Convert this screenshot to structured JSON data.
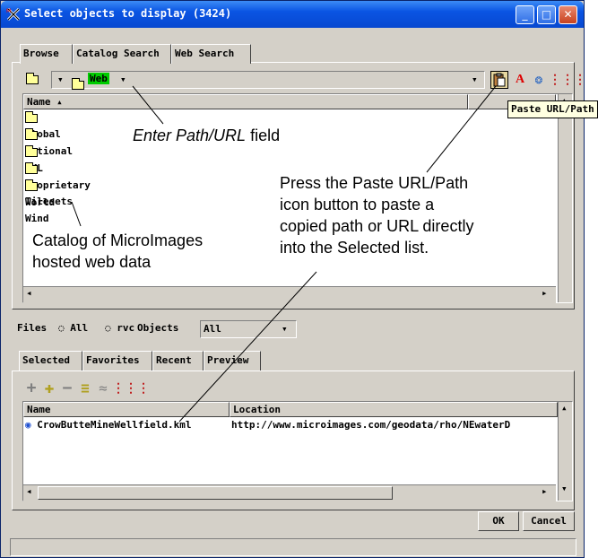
{
  "window": {
    "title": "Select objects to display (3424)",
    "controls": [
      "minimize",
      "maximize",
      "close"
    ]
  },
  "tabs_top": [
    "Browse",
    "Catalog Search",
    "Web Search"
  ],
  "path_bar": {
    "value": "Web",
    "value_color": "#00cc00",
    "icons": [
      "up-folder-icon",
      "paste-url-icon",
      "pdf-icon",
      "web-icon",
      "grid-icon"
    ]
  },
  "browse_list": {
    "header": "Name",
    "sort": "ascending",
    "items": [
      "Global",
      "National",
      "KML",
      "Proprietary Tilesets",
      "World Wind"
    ]
  },
  "tooltip": "Paste URL/Path",
  "files_row": {
    "files_label": "Files",
    "all_label": "All",
    "rvc_label": "rvc",
    "objects_label": "Objects",
    "objects_value": "All"
  },
  "tabs_bottom": [
    "Selected",
    "Favorites",
    "Recent",
    "Preview"
  ],
  "selected_list": {
    "columns": [
      "Name",
      "Location"
    ],
    "rows": [
      {
        "name": "CrowButteMineWellfield.kml",
        "location": "http://www.microimages.com/geodata/rho/NEwaterD"
      }
    ]
  },
  "buttons": {
    "ok": "OK",
    "cancel": "Cancel"
  },
  "annotations": {
    "path_field_em": "Enter Path/URL",
    "path_field_rest": " field",
    "paste_note": [
      "Press the Paste URL/Path",
      "icon button to paste a",
      "copied path or URL directly",
      "into the Selected list."
    ],
    "catalog_note": [
      "Catalog of MicroImages",
      "hosted web data"
    ]
  }
}
